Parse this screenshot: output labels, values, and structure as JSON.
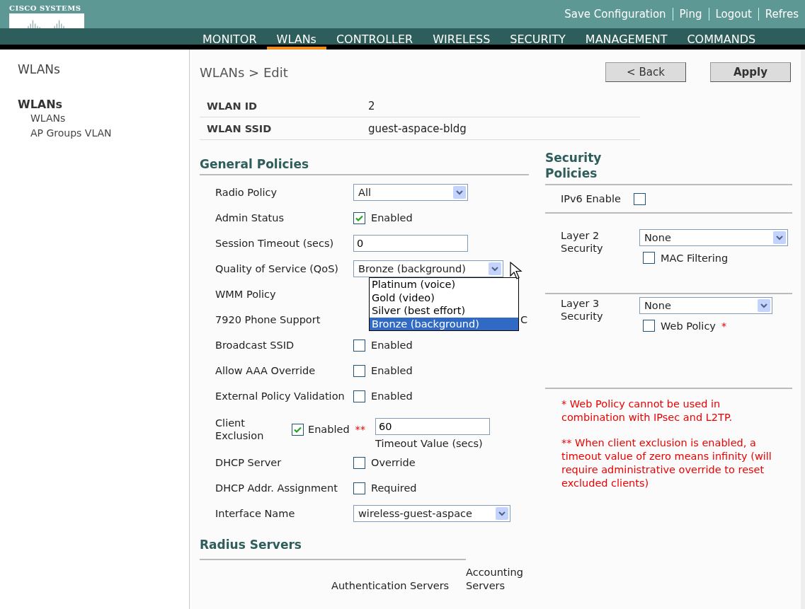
{
  "header": {
    "logo": "CISCO SYSTEMS",
    "links": [
      "Save Configuration",
      "Ping",
      "Logout",
      "Refres"
    ],
    "nav": [
      {
        "label": "MONITOR",
        "selected": false
      },
      {
        "label": "WLANs",
        "selected": true
      },
      {
        "label": "CONTROLLER",
        "selected": false
      },
      {
        "label": "WIRELESS",
        "selected": false
      },
      {
        "label": "SECURITY",
        "selected": false
      },
      {
        "label": "MANAGEMENT",
        "selected": false
      },
      {
        "label": "COMMANDS",
        "selected": false
      }
    ]
  },
  "sidebar": {
    "title": "WLANs",
    "section": "WLANs",
    "items": [
      "WLANs",
      "AP Groups VLAN"
    ]
  },
  "page": {
    "title": "WLANs > Edit",
    "buttons": [
      "< Back",
      "Apply"
    ]
  },
  "info": [
    {
      "label": "WLAN ID",
      "value": "2"
    },
    {
      "label": "WLAN SSID",
      "value": "guest-aspace-bldg"
    }
  ],
  "general_policies": {
    "title": "General Policies",
    "rows": [
      {
        "kind": "select",
        "label": "Radio Policy",
        "value": "All"
      },
      {
        "kind": "checkbox",
        "label": "Admin Status",
        "checked": true,
        "text": "Enabled"
      },
      {
        "kind": "input",
        "label": "Session Timeout (secs)",
        "value": "0"
      },
      {
        "kind": "dropdown",
        "label": "Quality of Service (QoS)",
        "value": "Bronze (background)",
        "options": [
          {
            "label": "Platinum (voice)",
            "selected": false
          },
          {
            "label": "Gold (video)",
            "selected": false
          },
          {
            "label": "Silver (best effort)",
            "selected": false
          },
          {
            "label": "Bronze (background)",
            "selected": true
          }
        ]
      },
      {
        "kind": "covered",
        "label": "WMM Policy"
      },
      {
        "kind": "covered",
        "label": "7920 Phone Support",
        "text": "C"
      },
      {
        "kind": "checkbox",
        "label": "Broadcast SSID",
        "checked": false,
        "text": "Enabled"
      },
      {
        "kind": "checkbox",
        "label": "Allow AAA Override",
        "checked": false,
        "text": "Enabled"
      },
      {
        "kind": "checkbox",
        "label": "External Policy Validation",
        "checked": false,
        "text": "Enabled"
      },
      {
        "kind": "exclusion",
        "label": "Client Exclusion",
        "checked": true,
        "text": "Enabled",
        "mark": "**",
        "value": "60",
        "hint": "Timeout Value (secs)"
      },
      {
        "kind": "checkbox",
        "label": "DHCP Server",
        "checked": false,
        "text": "Override"
      },
      {
        "kind": "checkbox",
        "label": "DHCP Addr. Assignment",
        "checked": false,
        "text": "Required"
      },
      {
        "kind": "select",
        "label": "Interface Name",
        "value": "wireless-guest-aspace"
      }
    ]
  },
  "security_policies": {
    "title": "Security Policies",
    "ipv6": {
      "label": "IPv6 Enable",
      "checked": false
    },
    "layers": [
      {
        "label": "Layer 2 Security",
        "value": "None",
        "option": {
          "label": "MAC Filtering",
          "checked": false
        }
      },
      {
        "label": "Layer 3 Security",
        "value": "None",
        "option": {
          "label": "Web Policy",
          "mark": "*",
          "checked": false
        }
      }
    ],
    "notes": [
      "* Web Policy cannot be used in combination with IPsec and L2TP.",
      "** When client exclusion is enabled, a timeout value of zero means infinity (will require administrative override to reset excluded clients)"
    ]
  },
  "radius": {
    "title": "Radius Servers",
    "columns": [
      "Authentication Servers",
      "Accounting Servers"
    ]
  }
}
